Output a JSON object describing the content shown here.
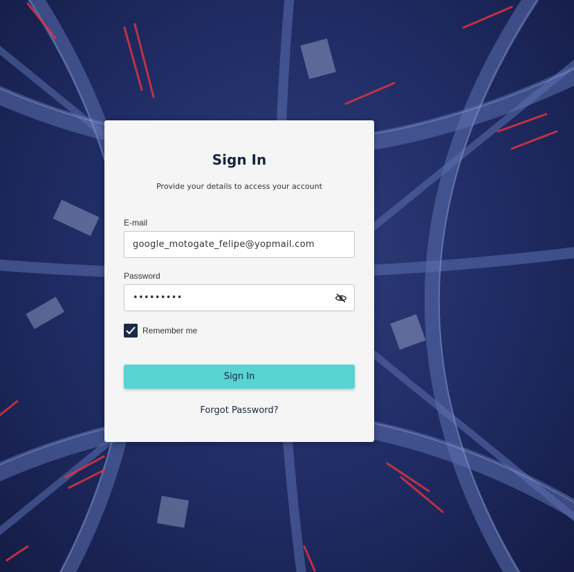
{
  "signin": {
    "title": "Sign In",
    "subtitle": "Provide your details to access your account",
    "email_label": "E-mail",
    "email_value": "google_motogate_felipe@yopmail.com",
    "password_label": "Password",
    "password_value": "•••••••••",
    "password_toggle_icon": "eye-off-icon",
    "remember_label": "Remember me",
    "remember_checked": true,
    "submit_label": "Sign In",
    "forgot_label": "Forgot Password?"
  },
  "colors": {
    "background": "#1f2b63",
    "card": "#f5f5f5",
    "accent_button": "#5ad3d3",
    "checkbox": "#1a2a47",
    "text_dark": "#17263f",
    "light_trails": "#e0333f"
  }
}
